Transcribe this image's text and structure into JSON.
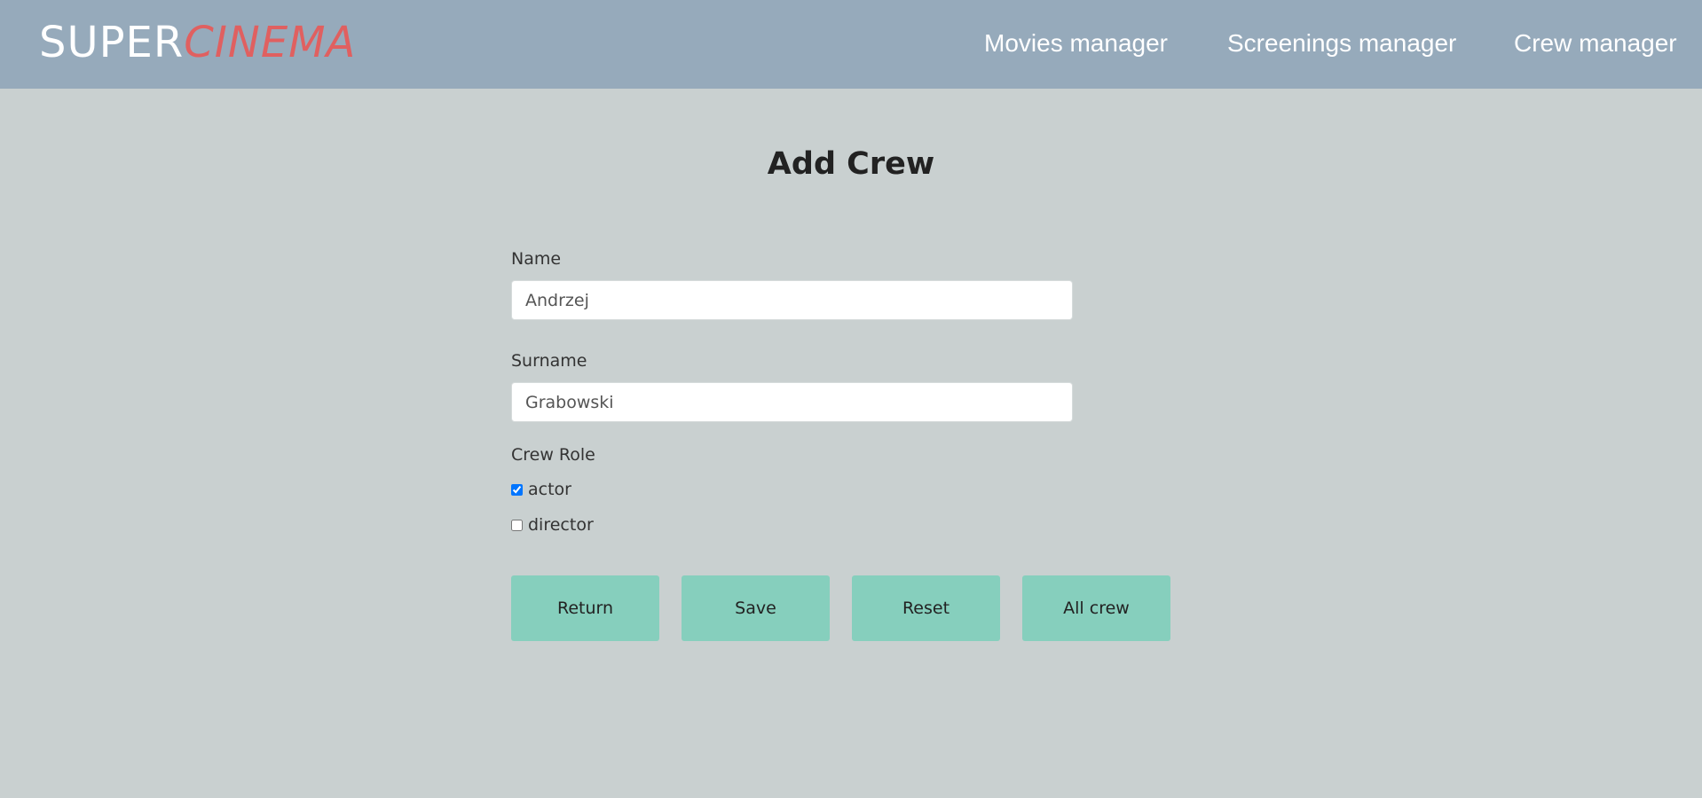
{
  "brand": {
    "part1": "SUPER",
    "part2": "CINEMA",
    "color_part1": "#ffffff",
    "color_part2": "#e06060"
  },
  "nav": {
    "movies": "Movies manager",
    "screenings": "Screenings manager",
    "crew": "Crew manager"
  },
  "page": {
    "title": "Add Crew"
  },
  "form": {
    "name_label": "Name",
    "name_value": "Andrzej",
    "surname_label": "Surname",
    "surname_value": "Grabowski",
    "role_label": "Crew Role",
    "roles": [
      {
        "label": "actor",
        "checked": true
      },
      {
        "label": "director",
        "checked": false
      }
    ]
  },
  "buttons": {
    "return": "Return",
    "save": "Save",
    "reset": "Reset",
    "all_crew": "All crew"
  },
  "colors": {
    "navbar": "#96aabb",
    "background": "#c9d0d0",
    "button": "#86cfbd"
  }
}
